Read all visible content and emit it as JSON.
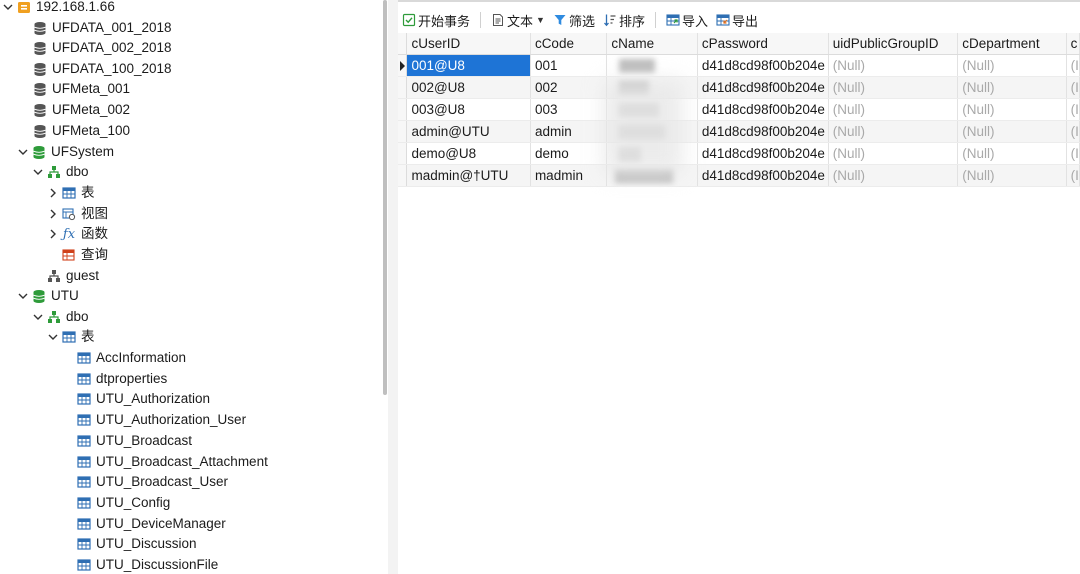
{
  "tree": {
    "server": "192.168.1.66",
    "databases_top": [
      "UFDATA_001_2018",
      "UFDATA_002_2018",
      "UFDATA_100_2018",
      "UFMeta_001",
      "UFMeta_002",
      "UFMeta_100"
    ],
    "ufsystem": {
      "name": "UFSystem",
      "dbo": "dbo",
      "tables": "表",
      "views": "视图",
      "functions": "函数",
      "queries": "查询",
      "guest": "guest"
    },
    "utu": {
      "name": "UTU",
      "dbo": "dbo",
      "tables": "表",
      "table_items": [
        "AccInformation",
        "dtproperties",
        "UTU_Authorization",
        "UTU_Authorization_User",
        "UTU_Broadcast",
        "UTU_Broadcast_Attachment",
        "UTU_Broadcast_User",
        "UTU_Config",
        "UTU_DeviceManager",
        "UTU_Discussion",
        "UTU_DiscussionFile"
      ]
    }
  },
  "toolbar": {
    "begin_transaction": "开始事务",
    "text": "文本",
    "filter": "筛选",
    "sort": "排序",
    "import": "导入",
    "export": "导出"
  },
  "grid": {
    "columns": [
      "cUserID",
      "cCode",
      "cName",
      "cPassword",
      "uidPublicGroupID",
      "cDepartment",
      "c"
    ],
    "rows": [
      {
        "cUserID": "001@U8",
        "cCode": "001",
        "cPassword": "d41d8cd98f00b204e",
        "uid": "(Null)",
        "dept": "(Null)",
        "extra": "(I"
      },
      {
        "cUserID": "002@U8",
        "cCode": "002",
        "cPassword": "d41d8cd98f00b204e",
        "uid": "(Null)",
        "dept": "(Null)",
        "extra": "(I"
      },
      {
        "cUserID": "003@U8",
        "cCode": "003",
        "cPassword": "d41d8cd98f00b204e",
        "uid": "(Null)",
        "dept": "(Null)",
        "extra": "(I"
      },
      {
        "cUserID": "admin@UTU",
        "cCode": "admin",
        "cPassword": "d41d8cd98f00b204e",
        "uid": "(Null)",
        "dept": "(Null)",
        "extra": "(I"
      },
      {
        "cUserID": "demo@U8",
        "cCode": "demo",
        "cPassword": "d41d8cd98f00b204e",
        "uid": "(Null)",
        "dept": "(Null)",
        "extra": "(I"
      },
      {
        "cUserID": "madmin@†UTU",
        "cCode": "madmin",
        "cPassword": "d41d8cd98f00b204e",
        "uid": "(Null)",
        "dept": "(Null)",
        "extra": "(I"
      }
    ]
  },
  "colors": {
    "selection": "#1e74d6",
    "db_icon": "#555555",
    "db_green": "#2e9b3a",
    "table_icon": "#2f6fb3",
    "server_icon": "#f0a020"
  }
}
